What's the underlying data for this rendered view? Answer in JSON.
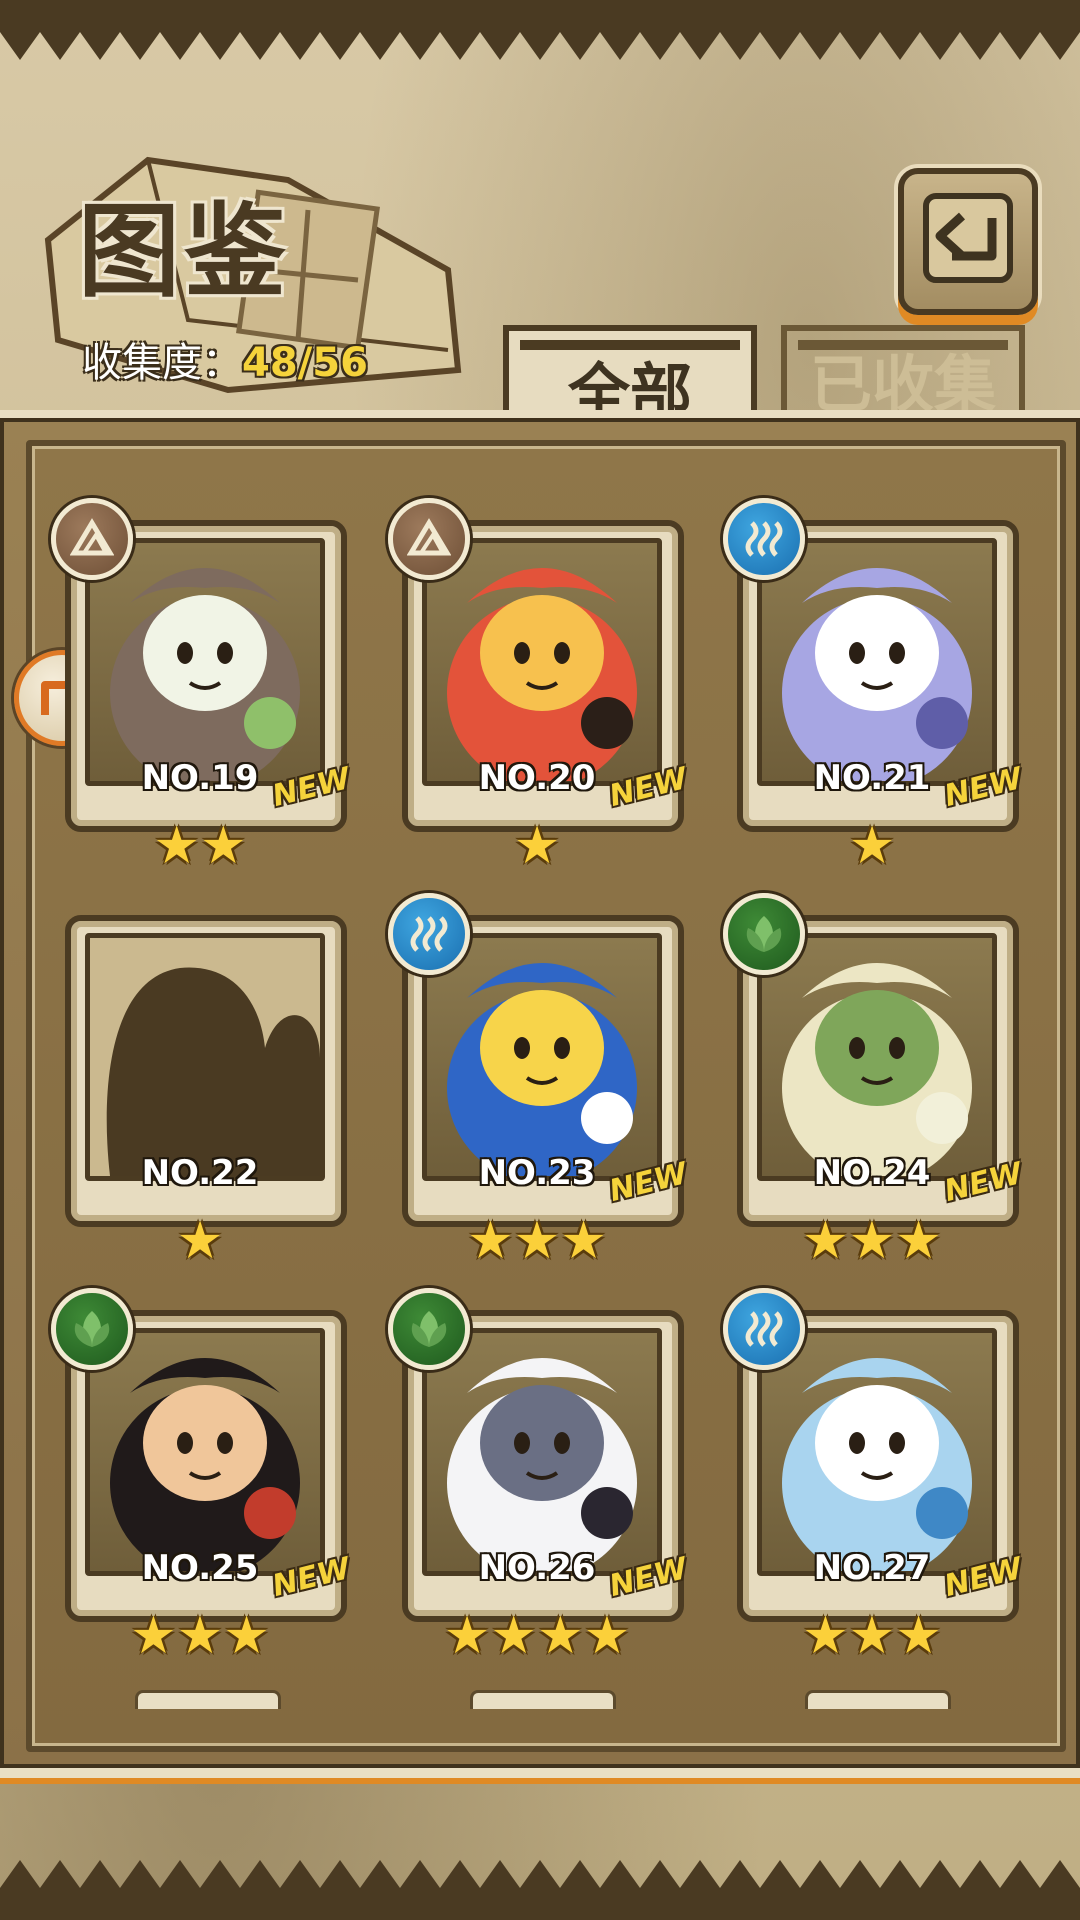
{
  "header": {
    "title": "图鉴",
    "collection_label": "收集度：",
    "collection_value": "48/56"
  },
  "tabs": [
    {
      "label": "全部",
      "active": true
    },
    {
      "label": "已收集",
      "active": false
    }
  ],
  "icons": {
    "back": "back-arrow-icon",
    "side": "side-arrow-icon",
    "earth": "mountain-icon",
    "water": "wave-icon",
    "grass": "leaf-icon"
  },
  "colors": {
    "accent_orange": "#e08a24",
    "star_yellow": "#fbd03a",
    "new_yellow": "#f5d33b"
  },
  "cards": [
    {
      "number": "NO.19",
      "stars": "★★",
      "new": "NEW",
      "element": "earth",
      "portrait_colors": [
        "#7e6b5e",
        "#f1f4e6",
        "#8fc06a"
      ]
    },
    {
      "number": "NO.20",
      "stars": "★",
      "new": "NEW",
      "element": "earth",
      "portrait_colors": [
        "#e3533a",
        "#f7c14e",
        "#2b1f18"
      ]
    },
    {
      "number": "NO.21",
      "stars": "★",
      "new": "NEW",
      "element": "water",
      "portrait_colors": [
        "#a7a6e3",
        "#ffffff",
        "#5f5ea8"
      ]
    },
    {
      "number": "NO.22",
      "stars": "★",
      "new": "",
      "element": "",
      "portrait_colors": [
        "#4a3a22",
        "#4a3a22",
        "#4a3a22"
      ]
    },
    {
      "number": "NO.23",
      "stars": "★★★",
      "new": "NEW",
      "element": "water",
      "portrait_colors": [
        "#2f66c6",
        "#f7d44a",
        "#ffffff"
      ]
    },
    {
      "number": "NO.24",
      "stars": "★★★",
      "new": "NEW",
      "element": "grass",
      "portrait_colors": [
        "#ece6c4",
        "#7fa65a",
        "#f2f0d9"
      ]
    },
    {
      "number": "NO.25",
      "stars": "★★★",
      "new": "NEW",
      "element": "grass",
      "portrait_colors": [
        "#201a1a",
        "#f0c69a",
        "#c23c2c"
      ]
    },
    {
      "number": "NO.26",
      "stars": "★★★★",
      "new": "NEW",
      "element": "grass",
      "portrait_colors": [
        "#f4f4f6",
        "#6a6f84",
        "#2a2630"
      ]
    },
    {
      "number": "NO.27",
      "stars": "★★★",
      "new": "NEW",
      "element": "water",
      "portrait_colors": [
        "#a9d4ef",
        "#ffffff",
        "#3f88c6"
      ]
    }
  ]
}
